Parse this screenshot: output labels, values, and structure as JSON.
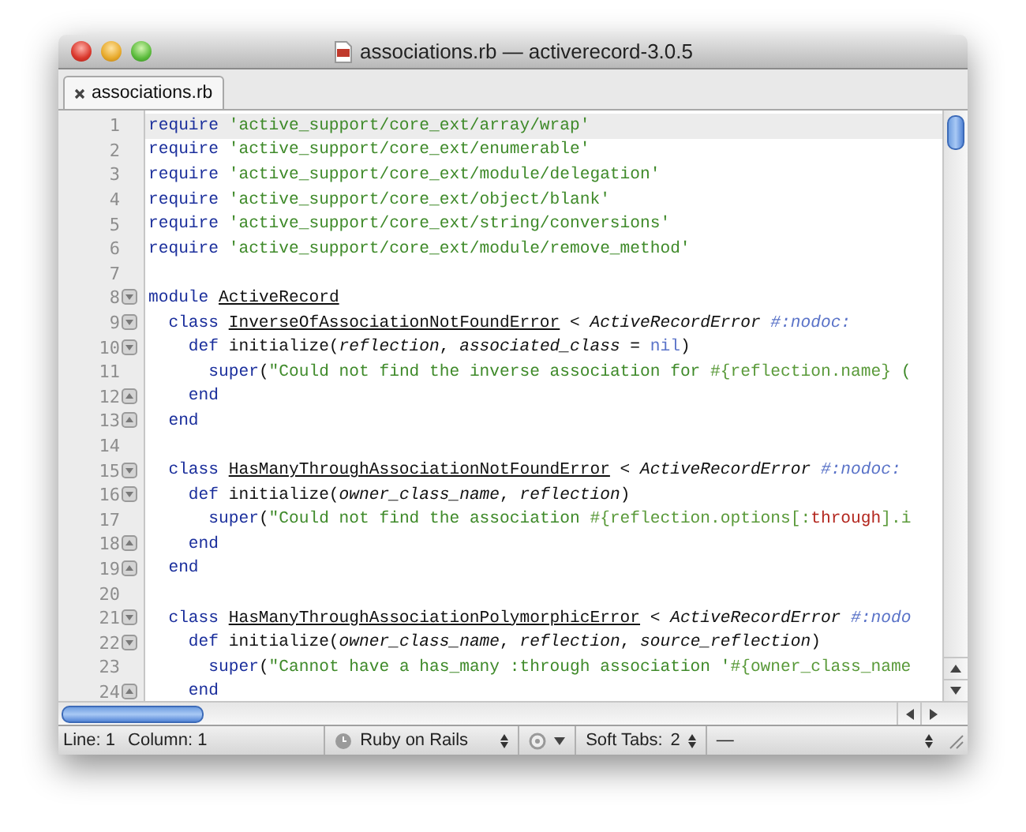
{
  "window": {
    "title": "associations.rb — activerecord-3.0.5"
  },
  "tabs": [
    {
      "label": "associations.rb",
      "selected": true
    }
  ],
  "editor": {
    "lines": [
      {
        "number": "1",
        "fold_start": false,
        "fold_end": false,
        "current": true,
        "tokens": [
          {
            "kind": "keyword",
            "text": "require "
          },
          {
            "kind": "string",
            "text": "'active_support/core_ext/array/wrap'"
          }
        ]
      },
      {
        "number": "2",
        "fold_start": false,
        "fold_end": false,
        "current": false,
        "tokens": [
          {
            "kind": "keyword",
            "text": "require "
          },
          {
            "kind": "string",
            "text": "'active_support/core_ext/enumerable'"
          }
        ]
      },
      {
        "number": "3",
        "fold_start": false,
        "fold_end": false,
        "current": false,
        "tokens": [
          {
            "kind": "keyword",
            "text": "require "
          },
          {
            "kind": "string",
            "text": "'active_support/core_ext/module/delegation'"
          }
        ]
      },
      {
        "number": "4",
        "fold_start": false,
        "fold_end": false,
        "current": false,
        "tokens": [
          {
            "kind": "keyword",
            "text": "require "
          },
          {
            "kind": "string",
            "text": "'active_support/core_ext/object/blank'"
          }
        ]
      },
      {
        "number": "5",
        "fold_start": false,
        "fold_end": false,
        "current": false,
        "tokens": [
          {
            "kind": "keyword",
            "text": "require "
          },
          {
            "kind": "string",
            "text": "'active_support/core_ext/string/conversions'"
          }
        ]
      },
      {
        "number": "6",
        "fold_start": false,
        "fold_end": false,
        "current": false,
        "tokens": [
          {
            "kind": "keyword",
            "text": "require "
          },
          {
            "kind": "string",
            "text": "'active_support/core_ext/module/remove_method'"
          }
        ]
      },
      {
        "number": "7",
        "fold_start": false,
        "fold_end": false,
        "current": false
      },
      {
        "number": "8",
        "fold_start": true,
        "fold_end": false,
        "current": false,
        "tokens": [
          {
            "kind": "keyword",
            "text": "module "
          },
          {
            "kind": "constant",
            "text": "ActiveRecord"
          }
        ]
      },
      {
        "number": "9",
        "fold_start": true,
        "fold_end": false,
        "current": false,
        "tokens": [
          {
            "kind": "keyword",
            "text": "  class "
          },
          {
            "kind": "constant",
            "text": "InverseOfAssociationNotFoundError"
          },
          {
            "kind": "text",
            "text": " < "
          },
          {
            "kind": "param",
            "text": "ActiveRecordError "
          },
          {
            "kind": "comment",
            "text": "#:nodoc:"
          }
        ]
      },
      {
        "number": "10",
        "fold_start": true,
        "fold_end": false,
        "current": false,
        "tokens": [
          {
            "kind": "keyword",
            "text": "    def "
          },
          {
            "kind": "text",
            "text": "initialize("
          },
          {
            "kind": "param",
            "text": "reflection"
          },
          {
            "kind": "text",
            "text": ", "
          },
          {
            "kind": "param",
            "text": "associated_class"
          },
          {
            "kind": "text",
            "text": " = "
          },
          {
            "kind": "constkw",
            "text": "nil"
          },
          {
            "kind": "text",
            "text": ")"
          }
        ]
      },
      {
        "number": "11",
        "fold_start": false,
        "fold_end": false,
        "current": false,
        "tokens": [
          {
            "kind": "keyword",
            "text": "      super"
          },
          {
            "kind": "text",
            "text": "("
          },
          {
            "kind": "string",
            "text": "\"Could not find the inverse association for "
          },
          {
            "kind": "interp",
            "text": "#{reflection.name}"
          },
          {
            "kind": "string",
            "text": " ("
          }
        ]
      },
      {
        "number": "12",
        "fold_start": false,
        "fold_end": true,
        "current": false,
        "tokens": [
          {
            "kind": "keyword",
            "text": "    end"
          }
        ]
      },
      {
        "number": "13",
        "fold_start": false,
        "fold_end": true,
        "current": false,
        "tokens": [
          {
            "kind": "keyword",
            "text": "  end"
          }
        ]
      },
      {
        "number": "14",
        "fold_start": false,
        "fold_end": false,
        "current": false
      },
      {
        "number": "15",
        "fold_start": true,
        "fold_end": false,
        "current": false,
        "tokens": [
          {
            "kind": "keyword",
            "text": "  class "
          },
          {
            "kind": "constant",
            "text": "HasManyThroughAssociationNotFoundError"
          },
          {
            "kind": "text",
            "text": " < "
          },
          {
            "kind": "param",
            "text": "ActiveRecordError "
          },
          {
            "kind": "comment",
            "text": "#:nodoc:"
          }
        ]
      },
      {
        "number": "16",
        "fold_start": true,
        "fold_end": false,
        "current": false,
        "tokens": [
          {
            "kind": "keyword",
            "text": "    def "
          },
          {
            "kind": "text",
            "text": "initialize("
          },
          {
            "kind": "param",
            "text": "owner_class_name"
          },
          {
            "kind": "text",
            "text": ", "
          },
          {
            "kind": "param",
            "text": "reflection"
          },
          {
            "kind": "text",
            "text": ")"
          }
        ]
      },
      {
        "number": "17",
        "fold_start": false,
        "fold_end": false,
        "current": false,
        "tokens": [
          {
            "kind": "keyword",
            "text": "      super"
          },
          {
            "kind": "text",
            "text": "("
          },
          {
            "kind": "string",
            "text": "\"Could not find the association "
          },
          {
            "kind": "interp",
            "text": "#{reflection.options[:"
          },
          {
            "kind": "symbol",
            "text": "through"
          },
          {
            "kind": "interp",
            "text": "].i"
          }
        ]
      },
      {
        "number": "18",
        "fold_start": false,
        "fold_end": true,
        "current": false,
        "tokens": [
          {
            "kind": "keyword",
            "text": "    end"
          }
        ]
      },
      {
        "number": "19",
        "fold_start": false,
        "fold_end": true,
        "current": false,
        "tokens": [
          {
            "kind": "keyword",
            "text": "  end"
          }
        ]
      },
      {
        "number": "20",
        "fold_start": false,
        "fold_end": false,
        "current": false
      },
      {
        "number": "21",
        "fold_start": true,
        "fold_end": false,
        "current": false,
        "tokens": [
          {
            "kind": "keyword",
            "text": "  class "
          },
          {
            "kind": "constant",
            "text": "HasManyThroughAssociationPolymorphicError"
          },
          {
            "kind": "text",
            "text": " < "
          },
          {
            "kind": "param",
            "text": "ActiveRecordError "
          },
          {
            "kind": "comment",
            "text": "#:nodo"
          }
        ]
      },
      {
        "number": "22",
        "fold_start": true,
        "fold_end": false,
        "current": false,
        "tokens": [
          {
            "kind": "keyword",
            "text": "    def "
          },
          {
            "kind": "text",
            "text": "initialize("
          },
          {
            "kind": "param",
            "text": "owner_class_name"
          },
          {
            "kind": "text",
            "text": ", "
          },
          {
            "kind": "param",
            "text": "reflection"
          },
          {
            "kind": "text",
            "text": ", "
          },
          {
            "kind": "param",
            "text": "source_reflection"
          },
          {
            "kind": "text",
            "text": ")"
          }
        ]
      },
      {
        "number": "23",
        "fold_start": false,
        "fold_end": false,
        "current": false,
        "tokens": [
          {
            "kind": "keyword",
            "text": "      super"
          },
          {
            "kind": "text",
            "text": "("
          },
          {
            "kind": "string",
            "text": "\"Cannot have a has_many :through association '"
          },
          {
            "kind": "interp",
            "text": "#{owner_class_name"
          }
        ]
      },
      {
        "number": "24",
        "fold_start": false,
        "fold_end": true,
        "current": false,
        "tokens": [
          {
            "kind": "keyword",
            "text": "    end"
          }
        ]
      }
    ]
  },
  "status_bar": {
    "line_label": "Line:",
    "line": "1",
    "column_label": "Column:",
    "column": "1",
    "language": "Ruby on Rails",
    "tabs_label": "Soft Tabs:",
    "tab_size": "2",
    "symbol": "—"
  }
}
